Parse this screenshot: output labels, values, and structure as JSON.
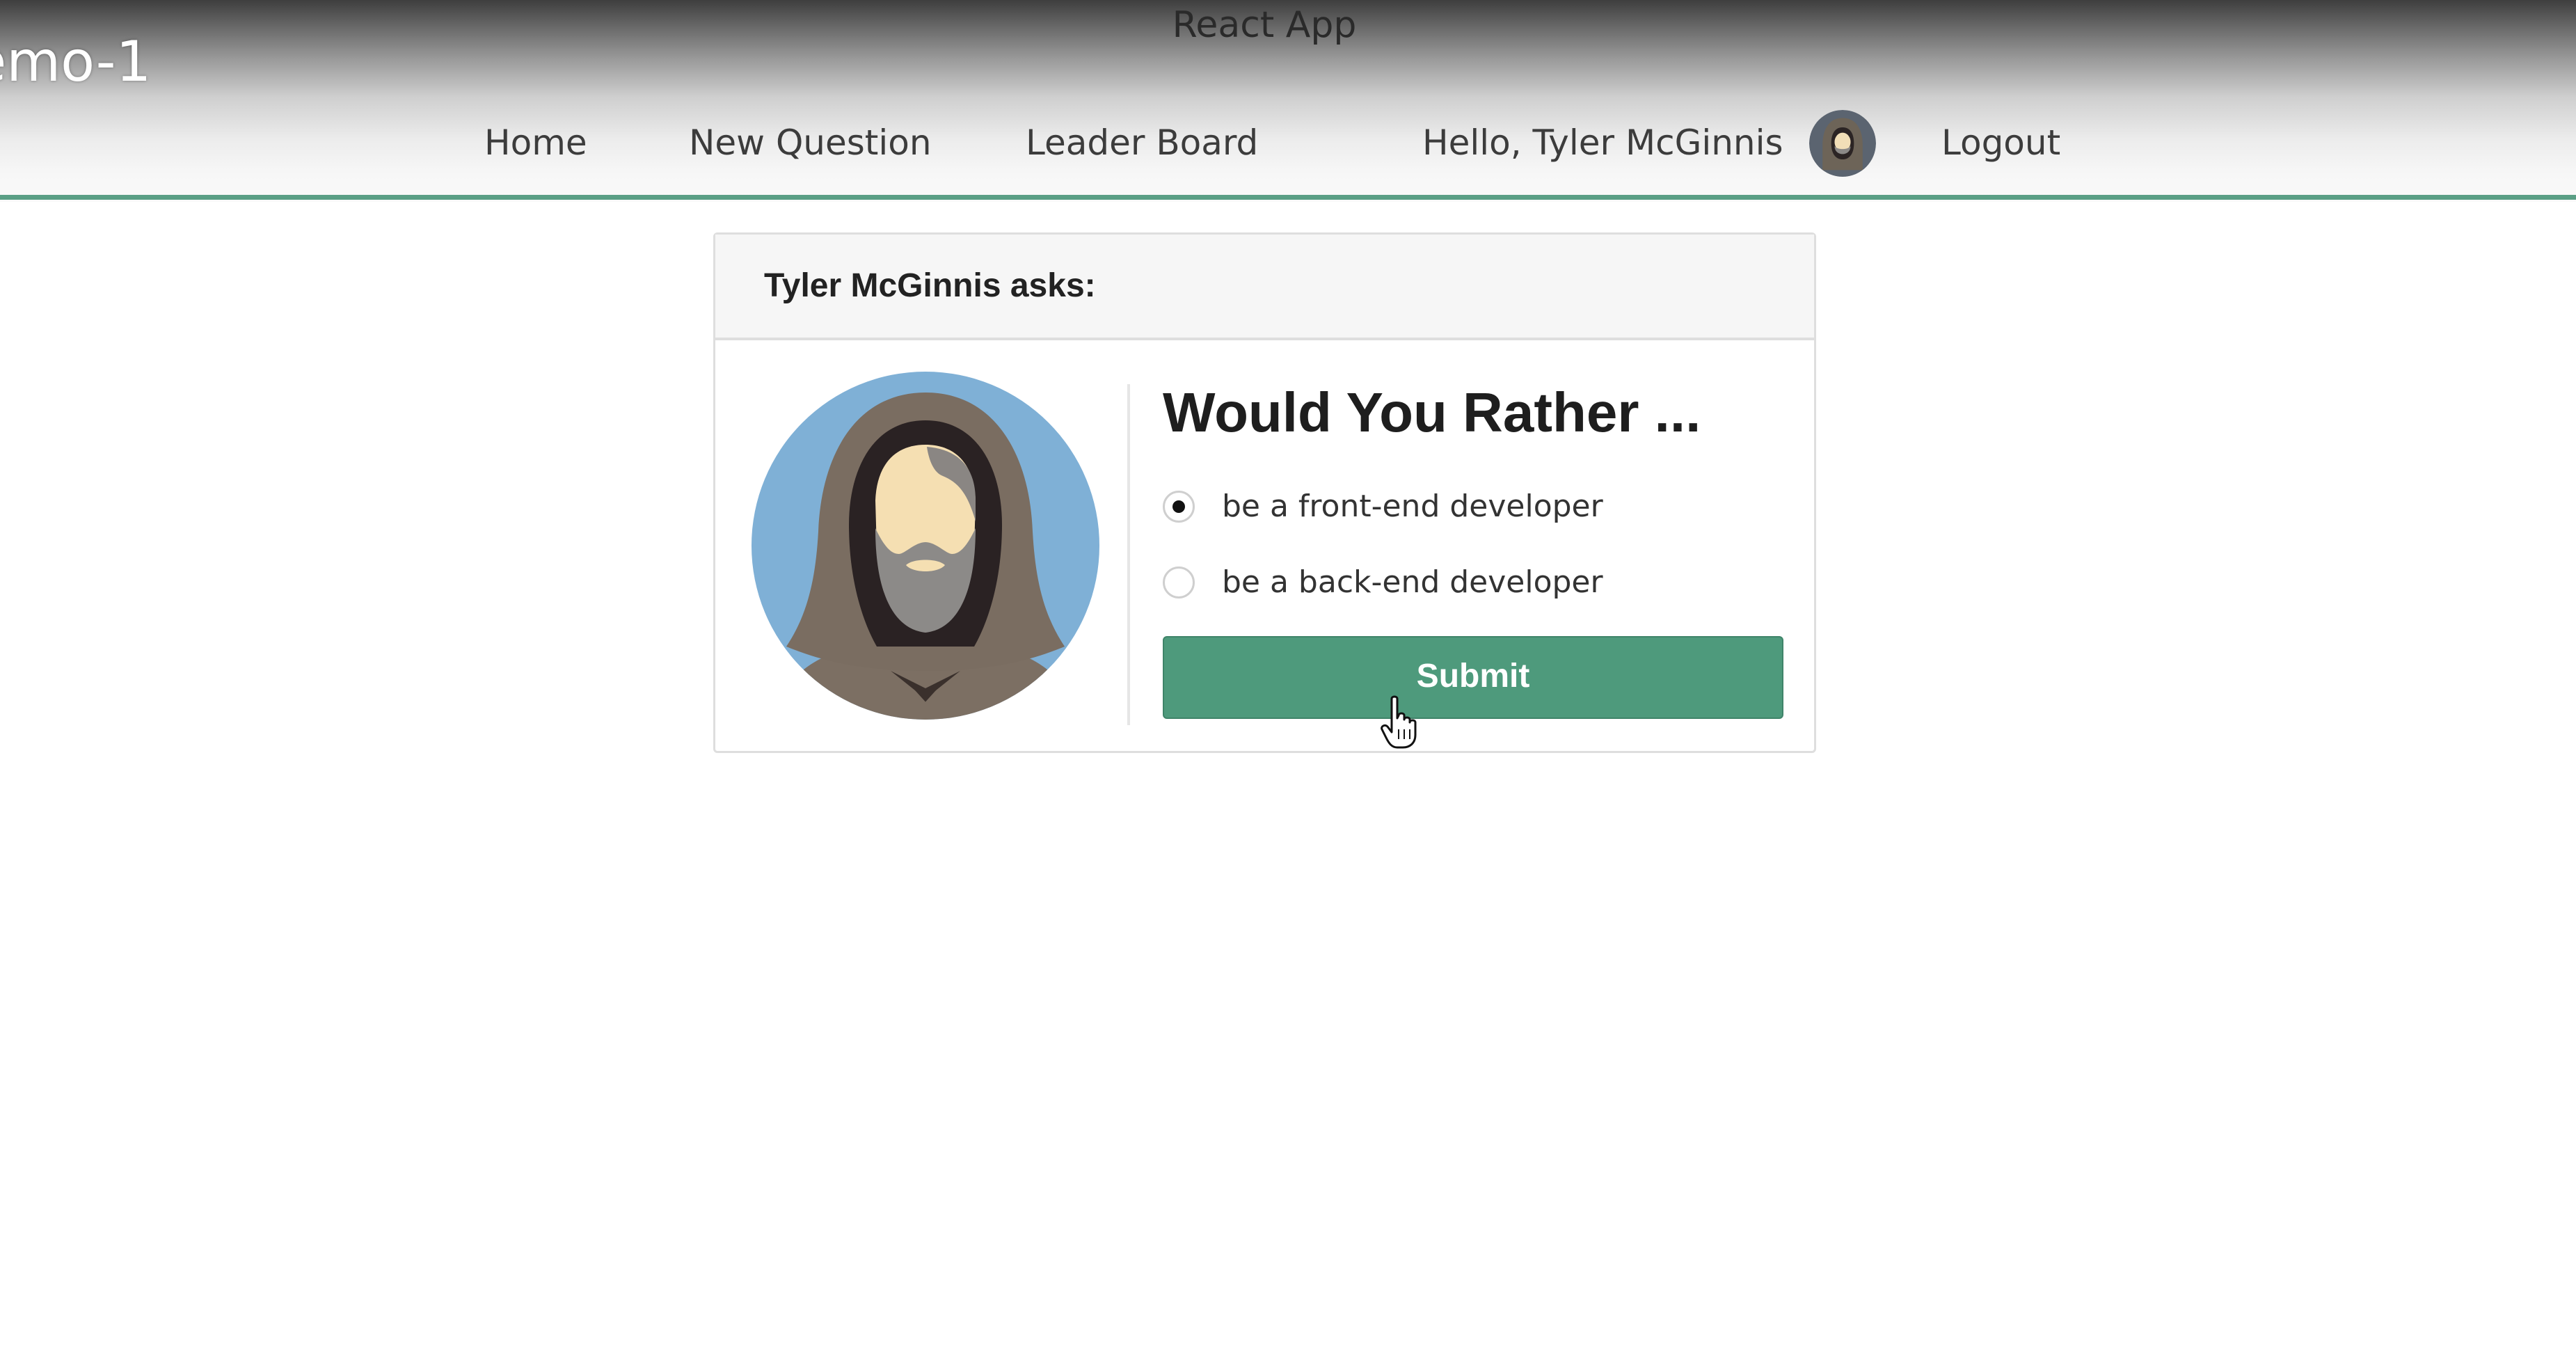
{
  "window": {
    "title": "React App",
    "demo_label": "emo-1"
  },
  "nav": {
    "items": [
      {
        "label": "Home"
      },
      {
        "label": "New Question"
      },
      {
        "label": "Leader Board"
      }
    ],
    "greeting": "Hello, Tyler McGinnis",
    "logout": "Logout",
    "accent_color": "#5a9f85"
  },
  "question": {
    "asker": "Tyler McGinnis asks:",
    "title": "Would You Rather ...",
    "options": [
      {
        "label": "be a front-end developer",
        "selected": true
      },
      {
        "label": "be a back-end developer",
        "selected": false
      }
    ],
    "submit_label": "Submit",
    "submit_color": "#4e9a7c",
    "avatar_icon": "hooded-bearded-man-avatar-icon"
  },
  "cursor_icon": "hand-pointer-cursor-icon"
}
